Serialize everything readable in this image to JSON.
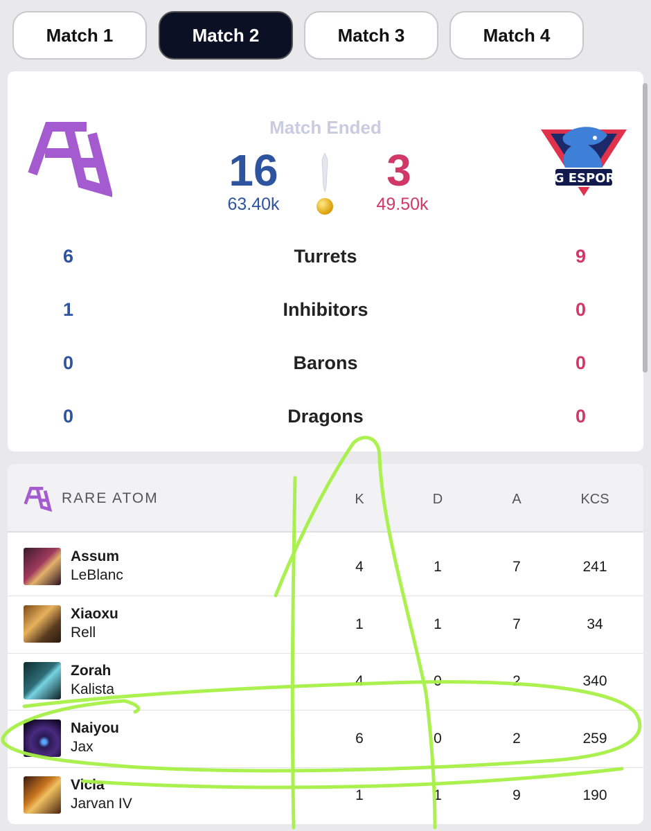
{
  "tabs": [
    {
      "label": "Match 1",
      "active": false
    },
    {
      "label": "Match 2",
      "active": true
    },
    {
      "label": "Match 3",
      "active": false
    },
    {
      "label": "Match 4",
      "active": false
    }
  ],
  "summary": {
    "status": "Match Ended",
    "left_team": {
      "kills": "16",
      "gold": "63.40k",
      "logo": "rare-atom-logo",
      "color": "#2e54a0"
    },
    "right_team": {
      "kills": "3",
      "gold": "49.50k",
      "logo": "lng-esports-logo",
      "logo_text": "LNG ESPORTS",
      "color": "#cf3867"
    },
    "objectives": [
      {
        "label": "Turrets",
        "left": "6",
        "right": "9"
      },
      {
        "label": "Inhibitors",
        "left": "1",
        "right": "0"
      },
      {
        "label": "Barons",
        "left": "0",
        "right": "0"
      },
      {
        "label": "Dragons",
        "left": "0",
        "right": "0"
      }
    ]
  },
  "stats_table": {
    "team": "RARE ATOM",
    "headers": {
      "k": "K",
      "d": "D",
      "a": "A",
      "kcs": "KCS"
    },
    "rows": [
      {
        "player": "Assum",
        "champion": "LeBlanc",
        "k": "4",
        "d": "1",
        "a": "7",
        "kcs": "241"
      },
      {
        "player": "Xiaoxu",
        "champion": "Rell",
        "k": "1",
        "d": "1",
        "a": "7",
        "kcs": "34"
      },
      {
        "player": "Zorah",
        "champion": "Kalista",
        "k": "4",
        "d": "0",
        "a": "2",
        "kcs": "340"
      },
      {
        "player": "Naiyou",
        "champion": "Jax",
        "k": "6",
        "d": "0",
        "a": "2",
        "kcs": "259"
      },
      {
        "player": "Vicla",
        "champion": "Jarvan IV",
        "k": "1",
        "d": "1",
        "a": "9",
        "kcs": "190"
      }
    ]
  },
  "annotation_color": "#a6f046"
}
